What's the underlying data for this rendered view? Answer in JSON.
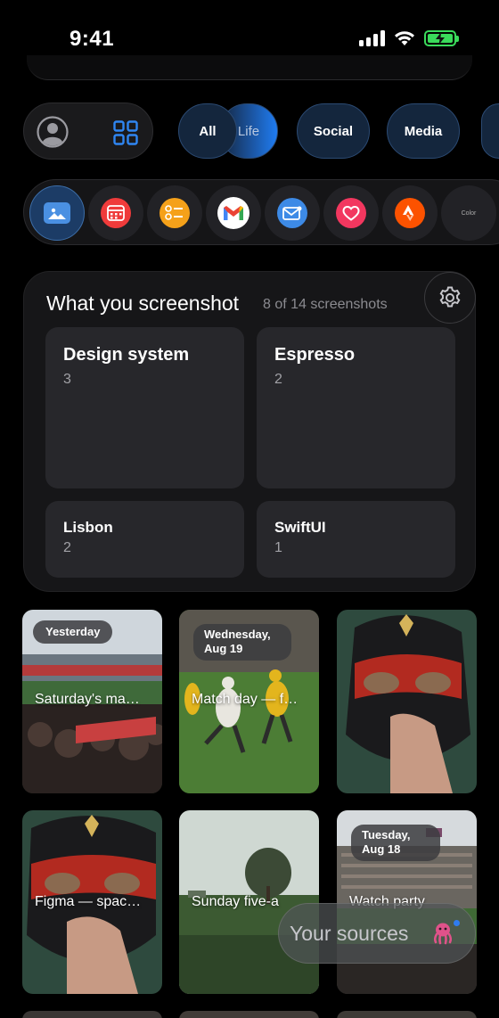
{
  "status_bar": {
    "time": "9:41"
  },
  "filters": {
    "chips": [
      {
        "label": "All"
      },
      {
        "label": "Life"
      },
      {
        "label": "Social"
      },
      {
        "label": "Media"
      }
    ]
  },
  "sources": [
    {
      "icon": "photos-icon"
    },
    {
      "icon": "calendar-icon"
    },
    {
      "icon": "reminders-icon"
    },
    {
      "icon": "gmail-icon"
    },
    {
      "icon": "mail-icon"
    },
    {
      "icon": "health-icon"
    },
    {
      "icon": "strava-icon"
    },
    {
      "icon": "colors-icon",
      "label": "Color"
    }
  ],
  "collections": {
    "title": "What you screenshot",
    "count": "8 of 14 screenshots",
    "tiles": [
      {
        "name": "Design system",
        "count": "3"
      },
      {
        "name": "Espresso",
        "count": "2"
      },
      {
        "name": "Lisbon",
        "count": "2"
      },
      {
        "name": "SwiftUI",
        "count": "1"
      }
    ]
  },
  "photos": [
    {
      "badge": "Yesterday",
      "caption": "Saturday's ma…"
    },
    {
      "badge": "Wednesday, Aug 19",
      "caption": "Match day — f…"
    },
    {
      "badge": "",
      "caption": ""
    },
    {
      "badge": "",
      "caption": "Figma — spac…"
    },
    {
      "badge": "",
      "caption": "Sunday five-a"
    },
    {
      "badge": "Tuesday, Aug 18",
      "caption": "Watch party"
    }
  ],
  "your_sources": {
    "label": "Your sources"
  },
  "colors": {
    "accent": "#1f7cf2",
    "card_bg": "#161618",
    "tile_bg": "#27272b",
    "background": "#000000"
  }
}
